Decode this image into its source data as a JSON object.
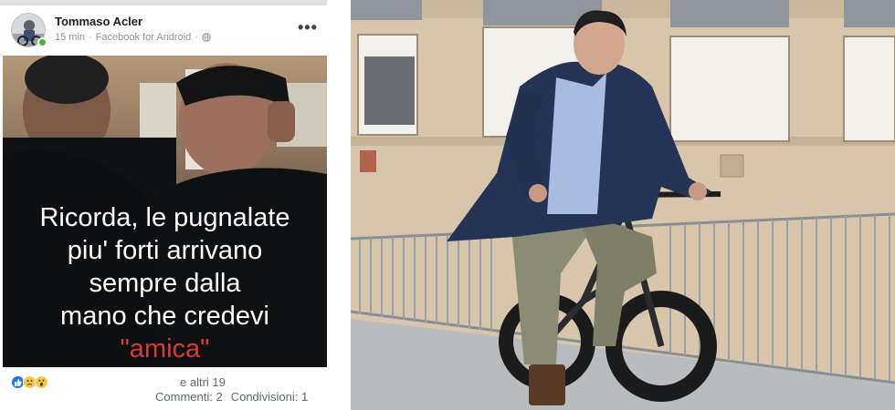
{
  "post": {
    "author": "Tommaso Acler",
    "time": "15 min",
    "separator": "·",
    "source": "Facebook for Android",
    "privacy_icon": "globe-icon",
    "more_icon": "more-options-icon",
    "more_label": "•••",
    "image_caption": {
      "line1": "Ricorda, le pugnalate",
      "line2": "piu' forti arrivano",
      "line3": "sempre dalla",
      "line4": "mano che credevi",
      "line5": "\"amica\""
    },
    "reactions": [
      "like-icon",
      "sad-icon",
      "wow-icon"
    ],
    "reaction_text": "e altri 19",
    "comments": "Commenti: 2",
    "shares": "Condivisioni: 1"
  },
  "colors": {
    "caption_text": "#ffffff",
    "caption_accent": "#d63a3a",
    "facebook_blue": "#1877f2",
    "online_green": "#42b72a"
  }
}
